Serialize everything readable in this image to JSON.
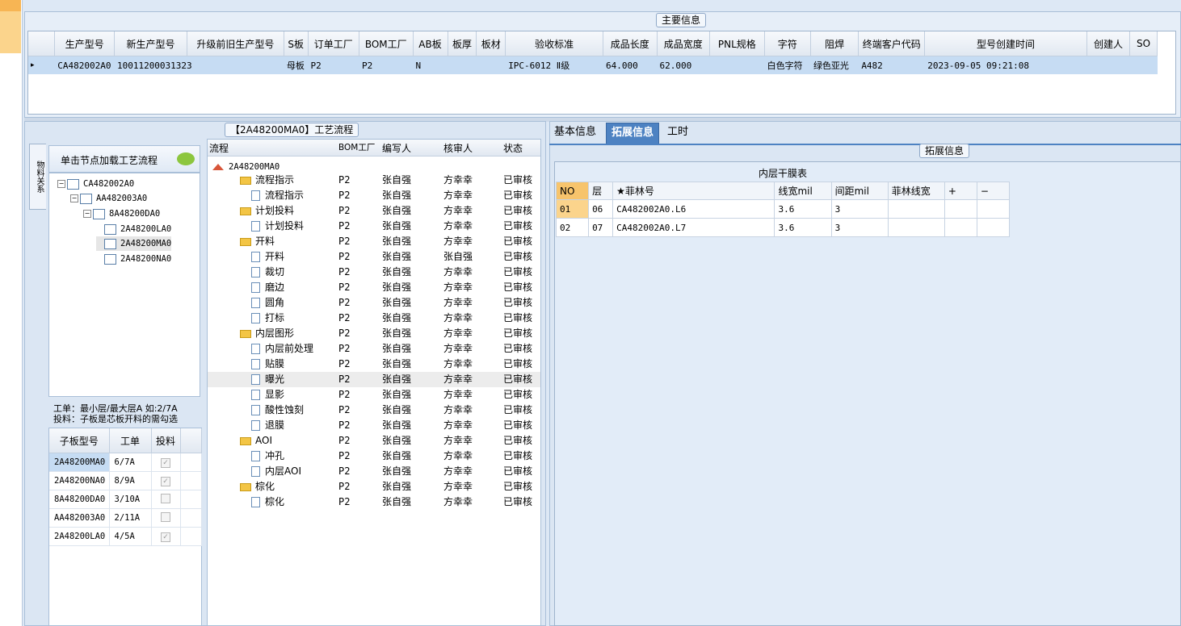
{
  "main_info": {
    "title": "主要信息",
    "columns": [
      "生产型号",
      "新生产型号",
      "升级前旧生产型号",
      "S板",
      "订单工厂",
      "BOM工厂",
      "AB板",
      "板厚",
      "板材",
      "验收标准",
      "成品长度",
      "成品宽度",
      "PNL规格",
      "字符",
      "阻焊",
      "终端客户代码",
      "型号创建时间",
      "创建人",
      "SO"
    ],
    "row": {
      "indicator": "▸",
      "cells": [
        "CA482002A0",
        "10011200031323",
        "",
        "母板",
        "P2",
        "P2",
        "N",
        "",
        "",
        "IPC-6012 Ⅱ级",
        "64.000",
        "62.000",
        "",
        "白色字符",
        "绿色亚光",
        "A482",
        "2023-09-05 09:21:08",
        "",
        ""
      ]
    }
  },
  "process_panel": {
    "title": "【2A48200MA0】工艺流程",
    "side_tab": "物料关系",
    "tree_header": "单击节点加载工艺流程",
    "tree": [
      {
        "label": "CA482002A0",
        "level": 0,
        "pm": "−"
      },
      {
        "label": "AA482003A0",
        "level": 1,
        "pm": "−"
      },
      {
        "label": "8A48200DA0",
        "level": 2,
        "pm": "−"
      },
      {
        "label": "2A48200LA0",
        "level": 3,
        "pm": ""
      },
      {
        "label": "2A48200MA0",
        "level": 3,
        "pm": ""
      },
      {
        "label": "2A48200NA0",
        "level": 3,
        "pm": ""
      }
    ],
    "hint_line1": "工单：最小层/最大层A 如:2/7A",
    "hint_line2": "投料：子板是芯板开料的需勾选",
    "sub_columns": [
      "子板型号",
      "工单",
      "投料"
    ],
    "sub_rows": [
      {
        "model": "2A48200MA0",
        "order": "6/7A",
        "checked": "✓"
      },
      {
        "model": "2A48200NA0",
        "order": "8/9A",
        "checked": "✓"
      },
      {
        "model": "8A48200DA0",
        "order": "3/10A",
        "checked": ""
      },
      {
        "model": "AA482003A0",
        "order": "2/11A",
        "checked": ""
      },
      {
        "model": "2A48200LA0",
        "order": "4/5A",
        "checked": "✓"
      }
    ],
    "flow_columns": [
      "流程",
      "BOM工厂",
      "编写人",
      "核审人",
      "状态"
    ],
    "flow_root": "2A48200MA0",
    "flow_rows": [
      {
        "name": "流程指示",
        "type": "folder",
        "bom": "P2",
        "writer": "张自强",
        "reviewer": "方幸幸",
        "status": "已审核"
      },
      {
        "name": "流程指示",
        "type": "leaf",
        "bom": "P2",
        "writer": "张自强",
        "reviewer": "方幸幸",
        "status": "已审核"
      },
      {
        "name": "计划投料",
        "type": "folder",
        "bom": "P2",
        "writer": "张自强",
        "reviewer": "方幸幸",
        "status": "已审核"
      },
      {
        "name": "计划投料",
        "type": "leaf",
        "bom": "P2",
        "writer": "张自强",
        "reviewer": "方幸幸",
        "status": "已审核"
      },
      {
        "name": "开料",
        "type": "folder",
        "bom": "P2",
        "writer": "张自强",
        "reviewer": "方幸幸",
        "status": "已审核"
      },
      {
        "name": "开料",
        "type": "leaf",
        "bom": "P2",
        "writer": "张自强",
        "reviewer": "张自强",
        "status": "已审核"
      },
      {
        "name": "裁切",
        "type": "leaf",
        "bom": "P2",
        "writer": "张自强",
        "reviewer": "方幸幸",
        "status": "已审核"
      },
      {
        "name": "磨边",
        "type": "leaf",
        "bom": "P2",
        "writer": "张自强",
        "reviewer": "方幸幸",
        "status": "已审核"
      },
      {
        "name": "圆角",
        "type": "leaf",
        "bom": "P2",
        "writer": "张自强",
        "reviewer": "方幸幸",
        "status": "已审核"
      },
      {
        "name": "打标",
        "type": "leaf",
        "bom": "P2",
        "writer": "张自强",
        "reviewer": "方幸幸",
        "status": "已审核"
      },
      {
        "name": "内层图形",
        "type": "folder",
        "bom": "P2",
        "writer": "张自强",
        "reviewer": "方幸幸",
        "status": "已审核"
      },
      {
        "name": "内层前处理",
        "type": "leaf",
        "bom": "P2",
        "writer": "张自强",
        "reviewer": "方幸幸",
        "status": "已审核"
      },
      {
        "name": "贴膜",
        "type": "leaf",
        "bom": "P2",
        "writer": "张自强",
        "reviewer": "方幸幸",
        "status": "已审核"
      },
      {
        "name": "曝光",
        "type": "leaf",
        "bom": "P2",
        "writer": "张自强",
        "reviewer": "方幸幸",
        "status": "已审核"
      },
      {
        "name": "显影",
        "type": "leaf",
        "bom": "P2",
        "writer": "张自强",
        "reviewer": "方幸幸",
        "status": "已审核"
      },
      {
        "name": "酸性蚀刻",
        "type": "leaf",
        "bom": "P2",
        "writer": "张自强",
        "reviewer": "方幸幸",
        "status": "已审核"
      },
      {
        "name": "退膜",
        "type": "leaf",
        "bom": "P2",
        "writer": "张自强",
        "reviewer": "方幸幸",
        "status": "已审核"
      },
      {
        "name": "AOI",
        "type": "folder",
        "bom": "P2",
        "writer": "张自强",
        "reviewer": "方幸幸",
        "status": "已审核"
      },
      {
        "name": "冲孔",
        "type": "leaf",
        "bom": "P2",
        "writer": "张自强",
        "reviewer": "方幸幸",
        "status": "已审核"
      },
      {
        "name": "内层AOI",
        "type": "leaf",
        "bom": "P2",
        "writer": "张自强",
        "reviewer": "方幸幸",
        "status": "已审核"
      },
      {
        "name": "棕化",
        "type": "folder",
        "bom": "P2",
        "writer": "张自强",
        "reviewer": "方幸幸",
        "status": "已审核"
      },
      {
        "name": "棕化",
        "type": "leaf",
        "bom": "P2",
        "writer": "张自强",
        "reviewer": "方幸幸",
        "status": "已审核"
      }
    ]
  },
  "right_panel": {
    "tabs": [
      "基本信息",
      "拓展信息",
      "工时"
    ],
    "active_tab": "拓展信息",
    "group_title": "拓展信息",
    "table_title": "内层干膜表",
    "columns": [
      "NO",
      "层",
      "★菲林号",
      "线宽mil",
      "间距mil",
      "菲林线宽",
      "+",
      "−"
    ],
    "rows": [
      [
        "01",
        "06",
        "CA482002A0.L6",
        "3.6",
        "3",
        "",
        "",
        ""
      ],
      [
        "02",
        "07",
        "CA482002A0.L7",
        "3.6",
        "3",
        "",
        "",
        ""
      ]
    ]
  },
  "colors": {
    "accent": "#4d82c2",
    "selection": "#c6dcf3",
    "background": "#dbe6f3"
  }
}
